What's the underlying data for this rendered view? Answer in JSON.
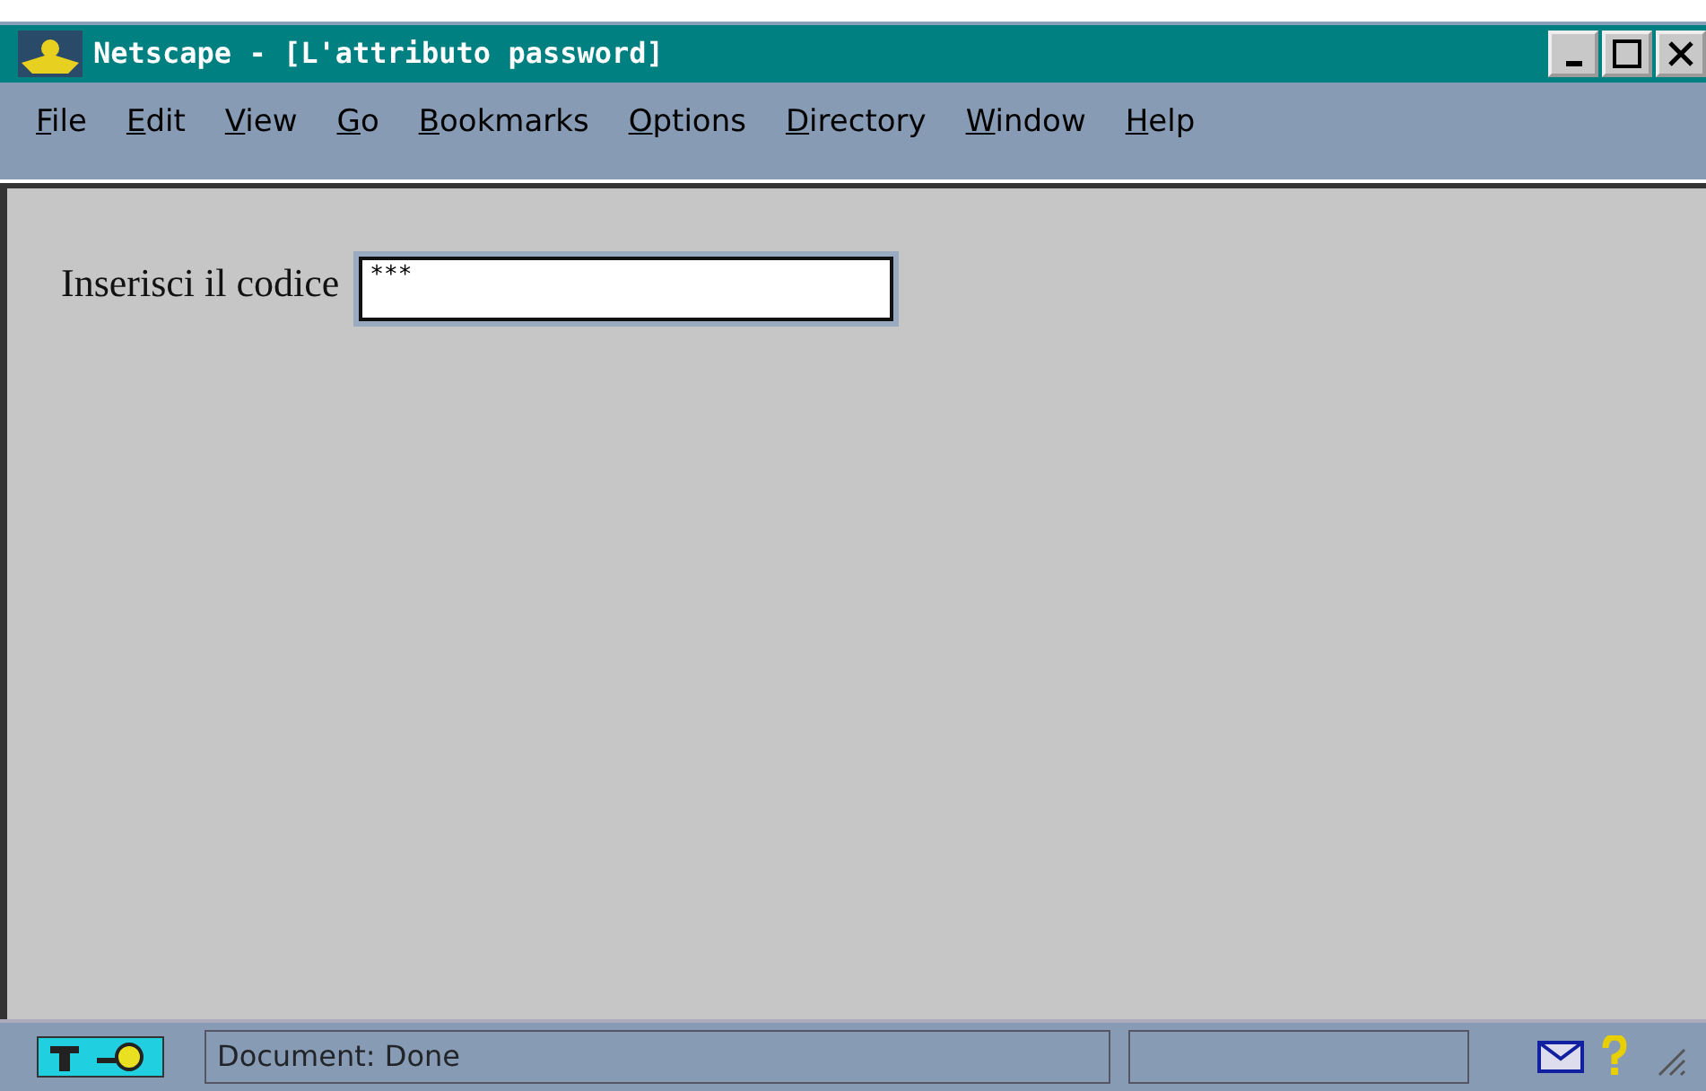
{
  "window": {
    "title": "Netscape - [L'attributo password]"
  },
  "menu": [
    {
      "access_key": "F",
      "rest": "ile"
    },
    {
      "access_key": "E",
      "rest": "dit"
    },
    {
      "access_key": "V",
      "rest": "iew"
    },
    {
      "access_key": "G",
      "rest": "o"
    },
    {
      "access_key": "B",
      "rest": "ookmarks"
    },
    {
      "access_key": "O",
      "rest": "ptions"
    },
    {
      "access_key": "D",
      "rest": "irectory"
    },
    {
      "access_key": "W",
      "rest": "indow"
    },
    {
      "access_key": "H",
      "rest": "elp"
    }
  ],
  "form": {
    "label": "Inserisci il codice",
    "value": "***"
  },
  "status_bar": {
    "text": "Document: Done"
  }
}
